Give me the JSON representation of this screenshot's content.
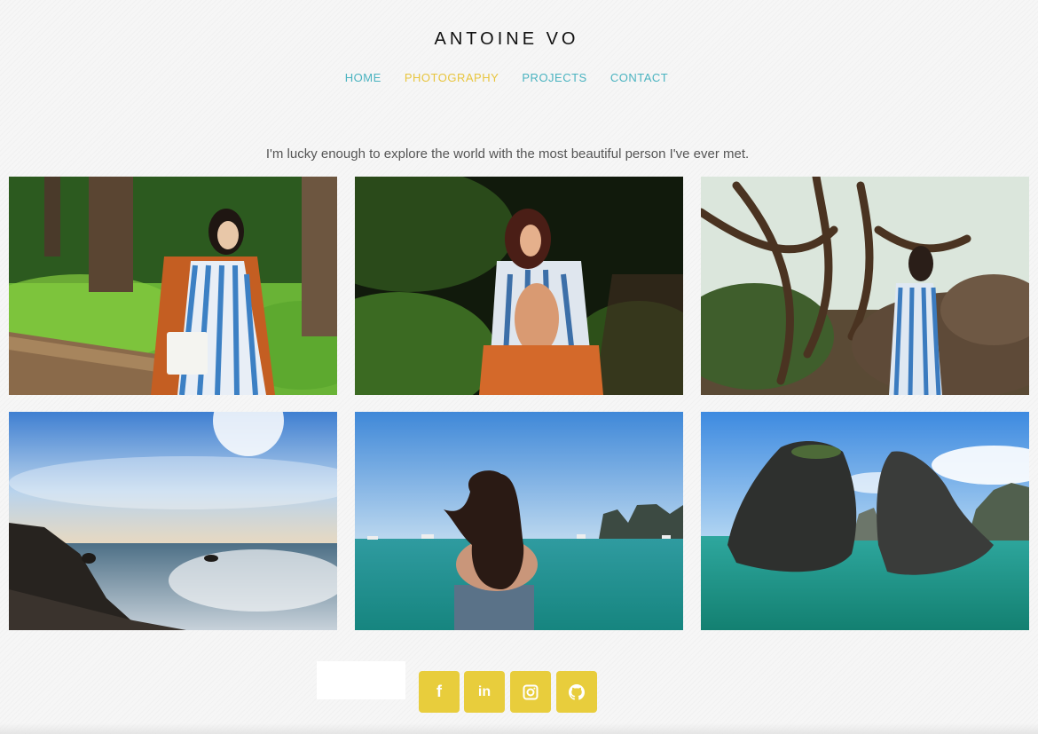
{
  "header": {
    "title": "ANTOINE VO"
  },
  "nav": {
    "items": [
      {
        "label": "HOME",
        "active": false
      },
      {
        "label": "PHOTOGRAPHY",
        "active": true
      },
      {
        "label": "PROJECTS",
        "active": false
      },
      {
        "label": "CONTACT",
        "active": false
      }
    ]
  },
  "main": {
    "tagline": "I'm lucky enough to explore the world with the most beautiful person I've ever met.",
    "photos": [
      {
        "subject": "forest-portrait-log"
      },
      {
        "subject": "forest-portrait-back"
      },
      {
        "subject": "tree-cypress-portrait"
      },
      {
        "subject": "rocky-coast-sunset"
      },
      {
        "subject": "bay-woman-back"
      },
      {
        "subject": "sea-rock-islands"
      }
    ]
  },
  "footer": {
    "social": [
      {
        "icon": "facebook-icon",
        "glyph": "f"
      },
      {
        "icon": "linkedin-icon",
        "glyph": "in"
      },
      {
        "icon": "instagram-icon",
        "glyph": ""
      },
      {
        "icon": "github-icon",
        "glyph": ""
      }
    ]
  },
  "colors": {
    "nav": "#4ab3c0",
    "nav_active": "#e8c53f",
    "social_button": "#e8cd3c",
    "background": "#f6f6f6"
  }
}
